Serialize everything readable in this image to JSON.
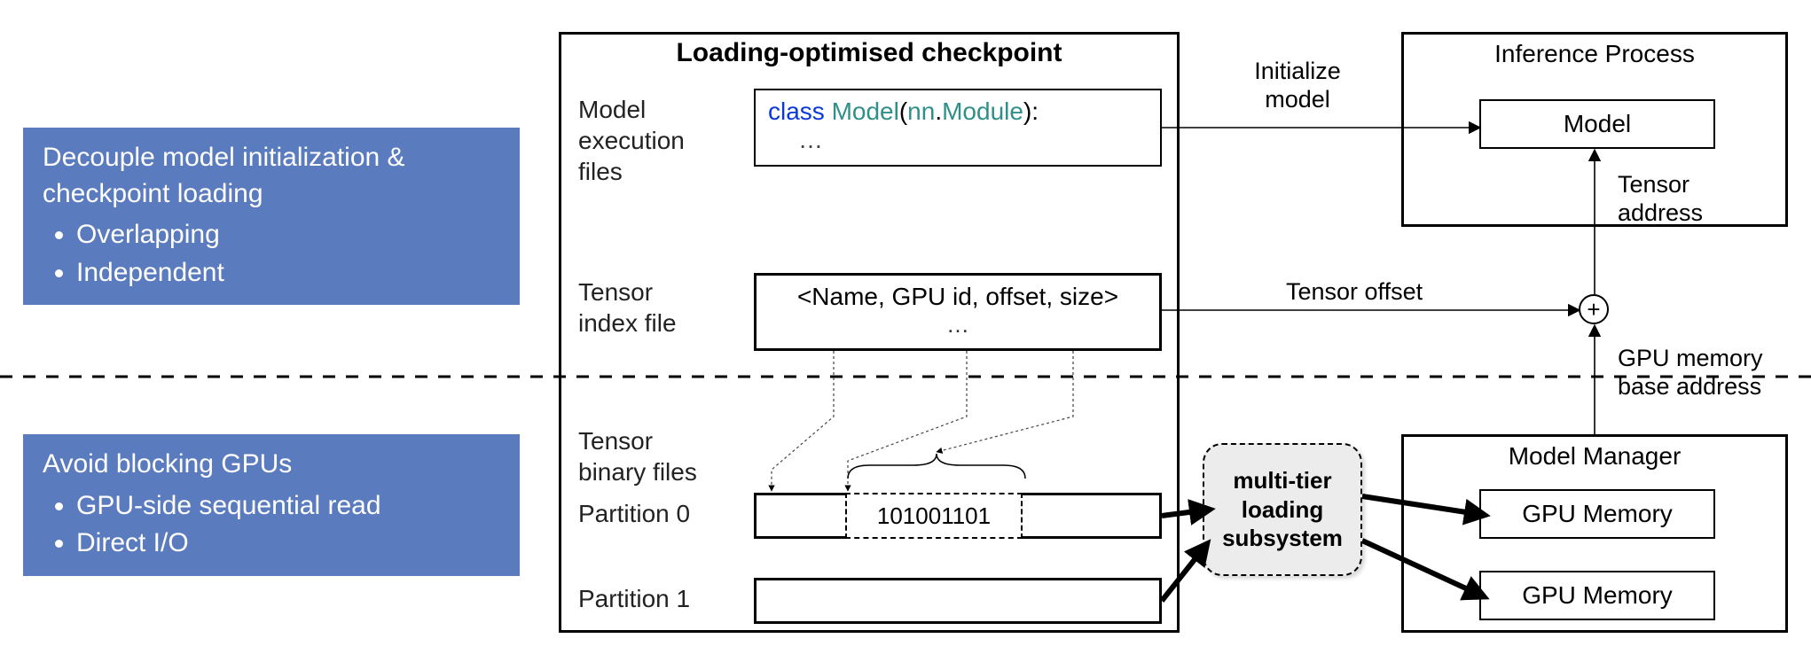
{
  "callouts": {
    "top": {
      "title": "Decouple model initialization & checkpoint loading",
      "bullet1": "Overlapping",
      "bullet2": "Independent"
    },
    "bottom": {
      "title": "Avoid blocking GPUs",
      "bullet1": "GPU-side sequential read",
      "bullet2": "Direct I/O"
    }
  },
  "checkpoint": {
    "heading": "Loading-optimised checkpoint",
    "exec_label": "Model\nexecution\nfiles",
    "code_kw_class": "class ",
    "code_model": "Model",
    "code_paren_open": "(",
    "code_nn": "nn",
    "code_dot": ".",
    "code_module": "Module",
    "code_paren_close": "):",
    "code_ellipsis": "…",
    "index_label": "Tensor\nindex file",
    "index_tuple": "<Name, GPU id, offset, size>",
    "index_ellipsis": "…",
    "binary_label": "Tensor\nbinary files",
    "partition0": "Partition 0",
    "partition1": "Partition 1",
    "p0_data": "101001101"
  },
  "inference": {
    "heading": "Inference Process",
    "model": "Model"
  },
  "manager": {
    "heading": "Model Manager",
    "gpu0": "GPU Memory",
    "gpu1": "GPU Memory"
  },
  "multitier": "multi-tier loading subsystem",
  "arrows": {
    "init_model": "Initialize model",
    "tensor_offset": "Tensor offset",
    "tensor_addr": "Tensor address",
    "gpu_base": "GPU memory base address"
  },
  "chart_data": {
    "type": "diagram",
    "description": "Architecture diagram of a loading-optimised checkpoint pipeline. Left blue callouts describe two design principles (decouple model initialization & checkpoint loading → overlapping, independent; avoid blocking GPUs → GPU-side sequential read, Direct I/O). Center box 'Loading-optimised checkpoint' contains model execution files (class Model(nn.Module)), tensor index file (<Name, GPU id, offset, size>), and tensor binary files split into Partition 0 and Partition 1. Arrows: execution files → Initialize model → Inference Process / Model; tensor index file → Tensor offset → plus node combined with GPU memory base address from Model Manager → Tensor address → Model; tensor binary partitions → multi-tier loading subsystem → GPU Memory ×2 in Model Manager.",
    "nodes": [
      {
        "id": "callout_top",
        "label": "Decouple model initialization & checkpoint loading",
        "bullets": [
          "Overlapping",
          "Independent"
        ]
      },
      {
        "id": "callout_bottom",
        "label": "Avoid blocking GPUs",
        "bullets": [
          "GPU-side sequential read",
          "Direct I/O"
        ]
      },
      {
        "id": "checkpoint",
        "label": "Loading-optimised checkpoint",
        "children": [
          "exec_files",
          "tensor_index",
          "tensor_bin_p0",
          "tensor_bin_p1"
        ]
      },
      {
        "id": "exec_files",
        "label": "Model execution files",
        "content": "class Model(nn.Module): …"
      },
      {
        "id": "tensor_index",
        "label": "Tensor index file",
        "content": "<Name, GPU id, offset, size> …"
      },
      {
        "id": "tensor_bin_p0",
        "label": "Partition 0",
        "content": "101001101"
      },
      {
        "id": "tensor_bin_p1",
        "label": "Partition 1"
      },
      {
        "id": "multitier",
        "label": "multi-tier loading subsystem"
      },
      {
        "id": "inference",
        "label": "Inference Process",
        "children": [
          "model_box"
        ]
      },
      {
        "id": "model_box",
        "label": "Model"
      },
      {
        "id": "manager",
        "label": "Model Manager",
        "children": [
          "gpu0",
          "gpu1"
        ]
      },
      {
        "id": "gpu0",
        "label": "GPU Memory"
      },
      {
        "id": "gpu1",
        "label": "GPU Memory"
      },
      {
        "id": "plus",
        "label": "+"
      }
    ],
    "edges": [
      {
        "from": "exec_files",
        "to": "model_box",
        "label": "Initialize model"
      },
      {
        "from": "tensor_index",
        "to": "plus",
        "label": "Tensor offset"
      },
      {
        "from": "manager",
        "to": "plus",
        "label": "GPU memory base address"
      },
      {
        "from": "plus",
        "to": "model_box",
        "label": "Tensor address"
      },
      {
        "from": "tensor_bin_p0",
        "to": "multitier"
      },
      {
        "from": "tensor_bin_p1",
        "to": "multitier"
      },
      {
        "from": "multitier",
        "to": "gpu0"
      },
      {
        "from": "multitier",
        "to": "gpu1"
      },
      {
        "from": "tensor_index",
        "to": "tensor_bin_p0",
        "style": "dotted",
        "note": "Name → byte span",
        "count": 3
      }
    ]
  }
}
